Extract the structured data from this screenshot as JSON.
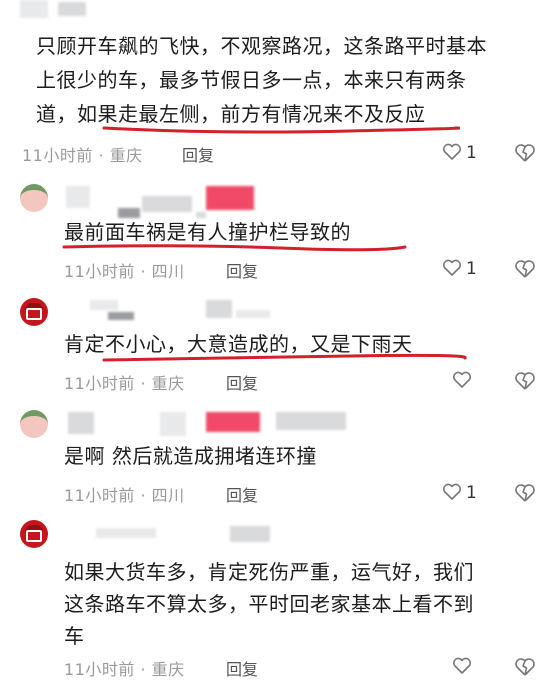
{
  "comments": [
    {
      "lines": [
        "只顾开车飙的飞快，不观察路况，这条路平时基本",
        "上很少的车，最多节假日多一点，本来只有两条",
        "道，如果走最左侧，前方有情况来不及反应"
      ],
      "time": "11小时前 · 重庆",
      "reply": "回复",
      "likes": "1"
    },
    {
      "lines": [
        "最前面车祸是有人撞护栏导致的"
      ],
      "time": "11小时前 · 四川",
      "reply": "回复",
      "likes": "1"
    },
    {
      "lines": [
        "肯定不小心，大意造成的，又是下雨天"
      ],
      "time": "11小时前 · 重庆",
      "reply": "回复",
      "likes": ""
    },
    {
      "lines": [
        "是啊 然后就造成拥堵连环撞"
      ],
      "time": "11小时前 · 四川",
      "reply": "回复",
      "likes": "1"
    },
    {
      "lines": [
        "如果大货车多，肯定死伤严重，运气好，我们",
        "这条路车不算太多，平时回老家基本上看不到",
        "车"
      ],
      "time": "11小时前 · 重庆",
      "reply": "回复",
      "likes": ""
    }
  ],
  "colors": {
    "underline": "#d4202c",
    "meta": "#9a9a9a",
    "avatar_red": "#c4161c"
  },
  "icons": {
    "like": "heart-outline-icon",
    "dislike": "broken-heart-icon"
  }
}
